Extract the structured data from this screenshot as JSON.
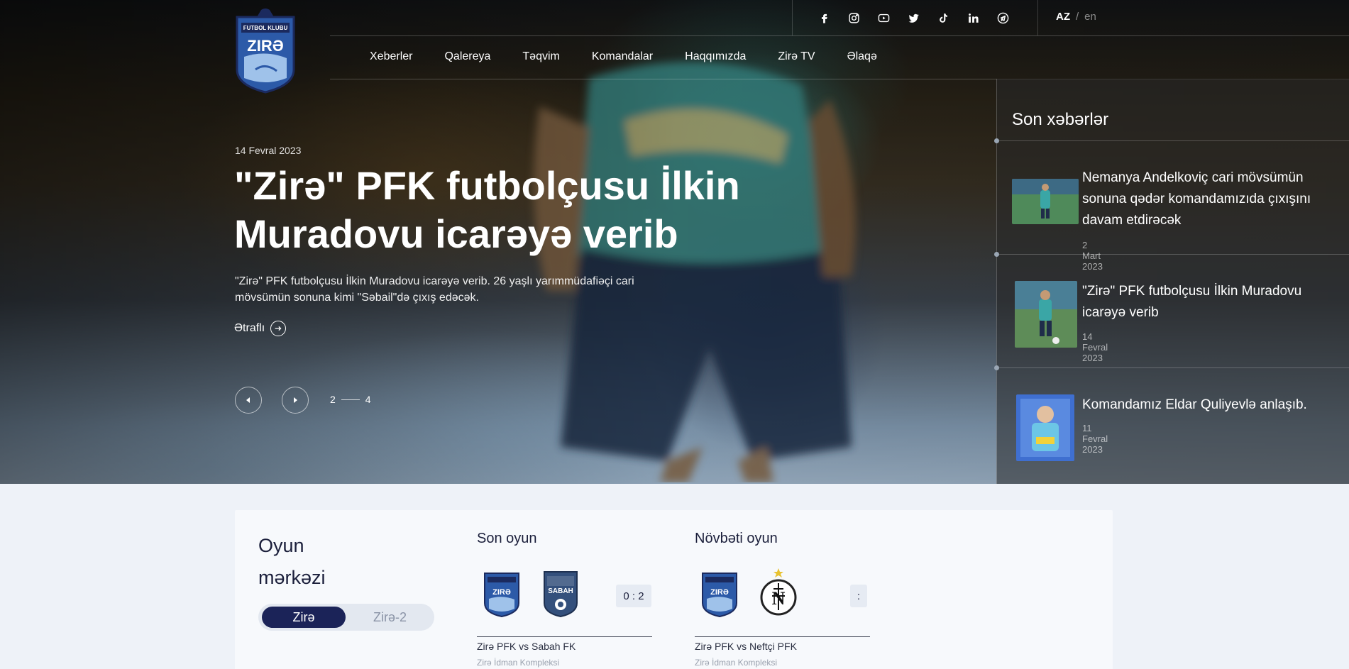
{
  "header": {
    "logo_text_top": "FUTBOL KLUBU",
    "logo_text_main": "ZIRƏ",
    "social_icons": [
      "facebook-icon",
      "instagram-icon",
      "youtube-icon",
      "twitter-icon",
      "tiktok-icon",
      "linkedin-icon",
      "telegram-icon"
    ],
    "lang_active": "AZ",
    "lang_sep": "/",
    "lang_other": "en"
  },
  "nav": {
    "items": [
      "Xeberler",
      "Qalereya",
      "Təqvim",
      "Komandalar",
      "Haqqımızda",
      "Zirə TV",
      "Əlaqə"
    ]
  },
  "slide": {
    "date": "14 Fevral 2023",
    "title": "\"Zirə\" PFK futbolçusu İlkin Muradovu icarəyə verib",
    "description": "\"Zirə\" PFK futbolçusu İlkin Muradovu icarəyə verib. 26 yaşlı yarımmüdafiəçi cari mövsümün sonuna kimi \"Səbail\"də çıxış edəcək.",
    "more_label": "Ətraflı",
    "current": "2",
    "total": "4"
  },
  "sidebar": {
    "title": "Son xəbərlər",
    "news": [
      {
        "title": "Nemanya Andelkoviç cari mövsümün sonuna qədər komandamızıda çıxışını davam etdirəcək",
        "date": "2 Mart 2023"
      },
      {
        "title": "\"Zirə\" PFK futbolçusu İlkin Muradovu icarəyə verib",
        "date": "14 Fevral 2023"
      },
      {
        "title": "Komandamız Eldar Quliyevlə anlaşıb.",
        "date": "11 Fevral 2023"
      }
    ]
  },
  "game_center": {
    "title_line1": "Oyun",
    "title_line2": "mərkəzi",
    "toggle_active": "Zirə",
    "toggle_other": "Zirə-2",
    "last_match": {
      "heading": "Son oyun",
      "home_crest_text": "ZIRƏ",
      "away_crest_text": "SABAH",
      "score": "0 : 2",
      "name": "Zirə PFK vs Sabah FK",
      "venue": "Zirə İdman Kompleksi"
    },
    "next_match": {
      "heading": "Növbəti oyun",
      "home_crest_text": "ZIRƏ",
      "away_crest_text": "N",
      "score": ":",
      "name": "Zirə PFK vs Neftçi PFK",
      "venue": "Zirə İdman Kompleksi"
    }
  },
  "colors": {
    "navy": "#1b2358",
    "crest_blue": "#2f5aa8",
    "accent_teal": "#3a9a98"
  }
}
